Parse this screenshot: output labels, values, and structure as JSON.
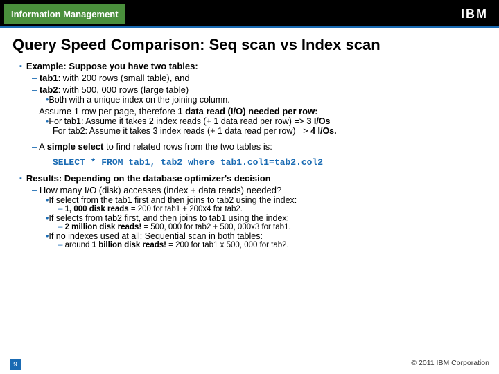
{
  "header": {
    "brand": "Information Management",
    "logo": "IBM"
  },
  "title": "Query Speed Comparison: Seq scan vs Index scan",
  "b1_head": "Example: Suppose you have two tables:",
  "b1_tab1_strong": "tab1",
  "b1_tab1_rest": ": with 200 rows (small table), and",
  "b1_tab2_strong": "tab2",
  "b1_tab2_rest": ": with 500, 000 rows (large table)",
  "b1_both": "Both with a unique index on the joining column.",
  "b1_assume_pre": "Assume 1 row per page, therefore ",
  "b1_assume_strong": "1 data read (I/O) needed per row:",
  "b1_io_tab1_pre": "For tab1: Assume it takes 2 index reads (+ 1 data read per row) => ",
  "b1_io_tab1_strong": "3 I/Os",
  "b1_io_tab2_pre": "For tab2: Assume it takes 3 index reads (+ 1 data read per row) => ",
  "b1_io_tab2_strong": "4 I/Os.",
  "b1_simple_pre": "A ",
  "b1_simple_strong": "simple select",
  "b1_simple_rest": " to find related rows from the two tables is:",
  "code": "SELECT * FROM tab1, tab2 where tab1.col1=tab2.col2",
  "r_head": "Results: Depending on the database optimizer's decision",
  "r_q": "How many I/O (disk) accesses (index + data reads) needed?",
  "r_c1": "If select from the tab1 first and then joins to tab2 using the index:",
  "r_c1_n_strong": "1, 000 disk reads",
  "r_c1_n_rest": " = 200 for tab1 + 200x4 for tab2.",
  "r_c2": "If selects from tab2 first, and then joins to tab1 using the index:",
  "r_c2_n_strong": "2 million disk reads!",
  "r_c2_n_rest": " = 500, 000 for tab2 + 500, 000x3 for tab1.",
  "r_c3": "If no indexes used at all: Sequential scan in both tables:",
  "r_c3_n_pre": "around ",
  "r_c3_n_strong": "1 billion disk reads!",
  "r_c3_n_rest": " = 200 for tab1 x 500, 000 for tab2.",
  "footer": {
    "page": "9",
    "copyright": "© 2011 IBM Corporation"
  }
}
